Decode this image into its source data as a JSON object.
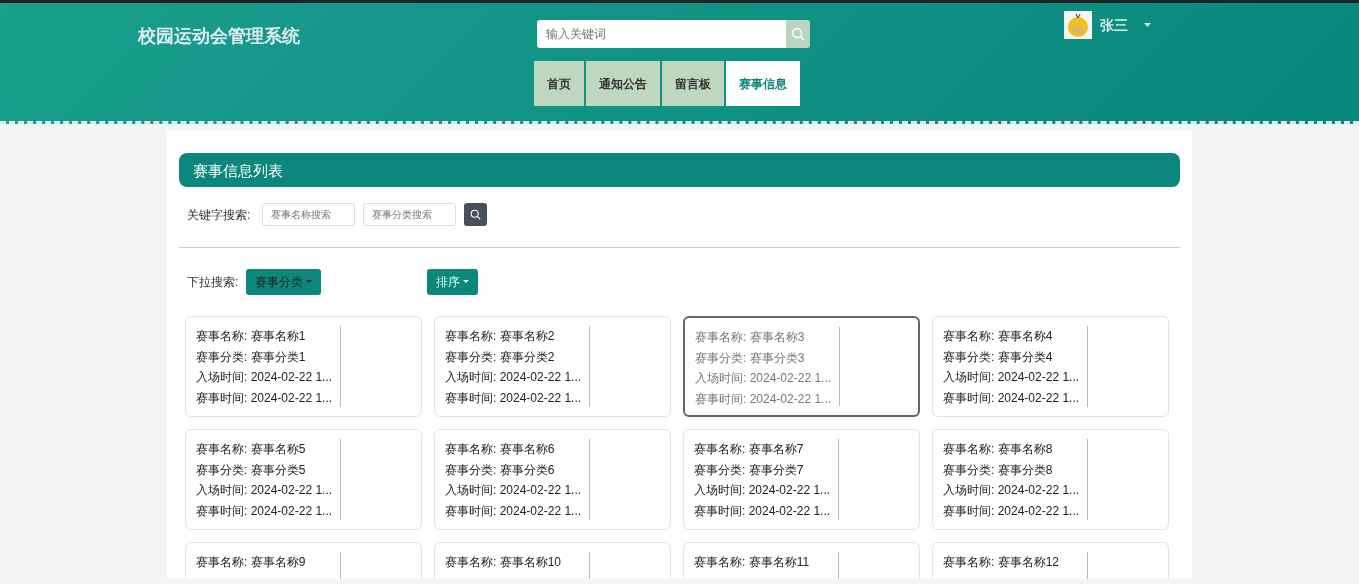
{
  "header": {
    "title": "校园运动会管理系统",
    "search": {
      "placeholder": "输入关键词"
    },
    "nav": [
      {
        "label": "首页",
        "selected": false
      },
      {
        "label": "通知公告",
        "selected": false
      },
      {
        "label": "留言板",
        "selected": false
      },
      {
        "label": "赛事信息",
        "selected": true
      }
    ],
    "user": {
      "name": "张三"
    }
  },
  "panel": {
    "title": "赛事信息列表",
    "keyword_search": {
      "label": "关键字搜索:",
      "fields": [
        {
          "placeholder": "赛事名称搜索"
        },
        {
          "placeholder": "赛事分类搜索"
        }
      ]
    },
    "dropdown_search": {
      "label": "下拉搜索:",
      "buttons": [
        "赛事分类",
        "排序"
      ]
    },
    "cards": [
      {
        "hovered": false,
        "lines": [
          "赛事名称: 赛事名称1",
          "赛事分类: 赛事分类1",
          "入场时间: 2024-02-22 1...",
          "赛事时间: 2024-02-22 1..."
        ]
      },
      {
        "hovered": false,
        "lines": [
          "赛事名称: 赛事名称2",
          "赛事分类: 赛事分类2",
          "入场时间: 2024-02-22 1...",
          "赛事时间: 2024-02-22 1..."
        ]
      },
      {
        "hovered": true,
        "lines": [
          "赛事名称: 赛事名称3",
          "赛事分类: 赛事分类3",
          "入场时间: 2024-02-22 1...",
          "赛事时间: 2024-02-22 1..."
        ]
      },
      {
        "hovered": false,
        "lines": [
          "赛事名称: 赛事名称4",
          "赛事分类: 赛事分类4",
          "入场时间: 2024-02-22 1...",
          "赛事时间: 2024-02-22 1..."
        ]
      },
      {
        "hovered": false,
        "lines": [
          "赛事名称: 赛事名称5",
          "赛事分类: 赛事分类5",
          "入场时间: 2024-02-22 1...",
          "赛事时间: 2024-02-22 1..."
        ]
      },
      {
        "hovered": false,
        "lines": [
          "赛事名称: 赛事名称6",
          "赛事分类: 赛事分类6",
          "入场时间: 2024-02-22 1...",
          "赛事时间: 2024-02-22 1..."
        ]
      },
      {
        "hovered": false,
        "lines": [
          "赛事名称: 赛事名称7",
          "赛事分类: 赛事分类7",
          "入场时间: 2024-02-22 1...",
          "赛事时间: 2024-02-22 1..."
        ]
      },
      {
        "hovered": false,
        "lines": [
          "赛事名称: 赛事名称8",
          "赛事分类: 赛事分类8",
          "入场时间: 2024-02-22 1...",
          "赛事时间: 2024-02-22 1..."
        ]
      },
      {
        "hovered": false,
        "lines": [
          "赛事名称: 赛事名称9"
        ]
      },
      {
        "hovered": false,
        "lines": [
          "赛事名称: 赛事名称10"
        ]
      },
      {
        "hovered": false,
        "lines": [
          "赛事名称: 赛事名称11"
        ]
      },
      {
        "hovered": false,
        "lines": [
          "赛事名称: 赛事名称12"
        ]
      }
    ]
  }
}
